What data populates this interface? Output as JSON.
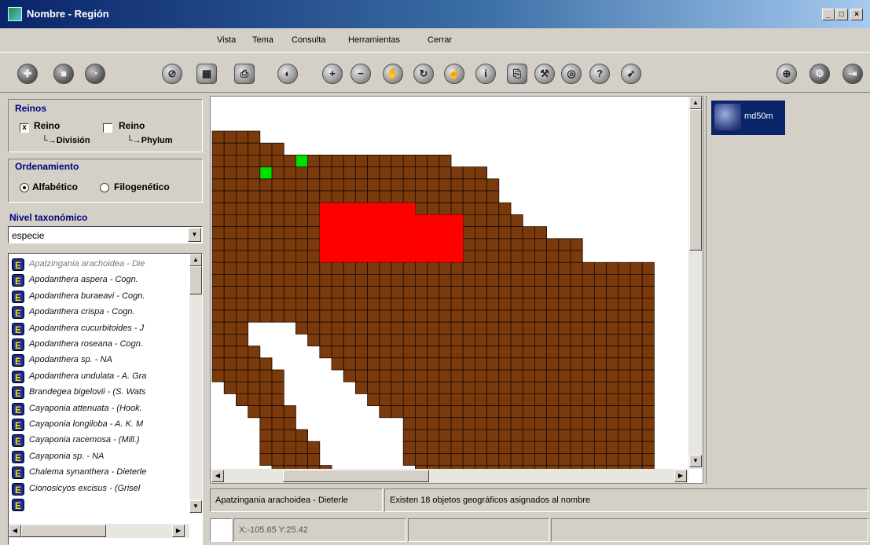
{
  "window": {
    "title": "Nombre - Región",
    "min": "_",
    "max": "□",
    "close": "×"
  },
  "menu": [
    {
      "label": "Vista"
    },
    {
      "label": "Tema"
    },
    {
      "label": "Consulta"
    },
    {
      "label": "Herramientas"
    },
    {
      "label": "Cerrar"
    }
  ],
  "toolbar_icons": [
    "add-icon",
    "stop-icon",
    "globe-icon",
    "eraser-icon",
    "layers-icon",
    "print-icon",
    "globe-alt-icon",
    "zoom-in-icon",
    "zoom-out-icon",
    "pan-icon",
    "refresh-icon",
    "hand-icon",
    "identify-icon",
    "print2-icon",
    "measure-icon",
    "select-icon",
    "query-icon",
    "map-icon",
    "crosshair-icon",
    "settings-icon",
    "exit-icon"
  ],
  "reinos": {
    "title": "Reinos",
    "option1": {
      "label": "Reino",
      "sub": "División",
      "checked": true,
      "mark": "x"
    },
    "option2": {
      "label": "Reino",
      "sub": "Phylum",
      "checked": false
    }
  },
  "ordenamiento": {
    "title": "Ordenamiento",
    "options": [
      {
        "label": "Alfabético",
        "selected": true
      },
      {
        "label": "Filogenético",
        "selected": false
      }
    ]
  },
  "nivel": {
    "title": "Nivel taxonómico",
    "value": "especie"
  },
  "list": {
    "icon_letter": "E",
    "items": [
      "Apatzingania arachoidea - Die",
      "Apodanthera aspera - Cogn.",
      "Apodanthera buraeavi - Cogn.",
      "Apodanthera crispa - Cogn.",
      "Apodanthera cucurbitoides - J",
      "Apodanthera roseana - Cogn.",
      "Apodanthera sp. - NA",
      "Apodanthera undulata - A. Gra",
      "Brandegea bigelovii - (S. Wats",
      "Cayaponia attenuata - (Hook.",
      "Cayaponia longiloba - A. K. M",
      "Cayaponia racemosa - (Mill.)",
      "Cayaponia sp. - NA",
      "Chalema synanthera - Dieterle",
      "Cionosicyos excisus - (Grisel",
      ""
    ]
  },
  "legend": {
    "label": "md50m"
  },
  "map": {
    "colors": {
      "cell": "#7b3a0c",
      "grid": "#1a0a00",
      "selected": "#ff0000",
      "green": "#00e000",
      "background": "#ffffff"
    }
  },
  "status": {
    "name": "Apatzingania arachoidea - Dieterle",
    "message": "Existen 18 objetos geográficos asignados al nombre",
    "coords": "X:-105.65 Y:25.42"
  }
}
